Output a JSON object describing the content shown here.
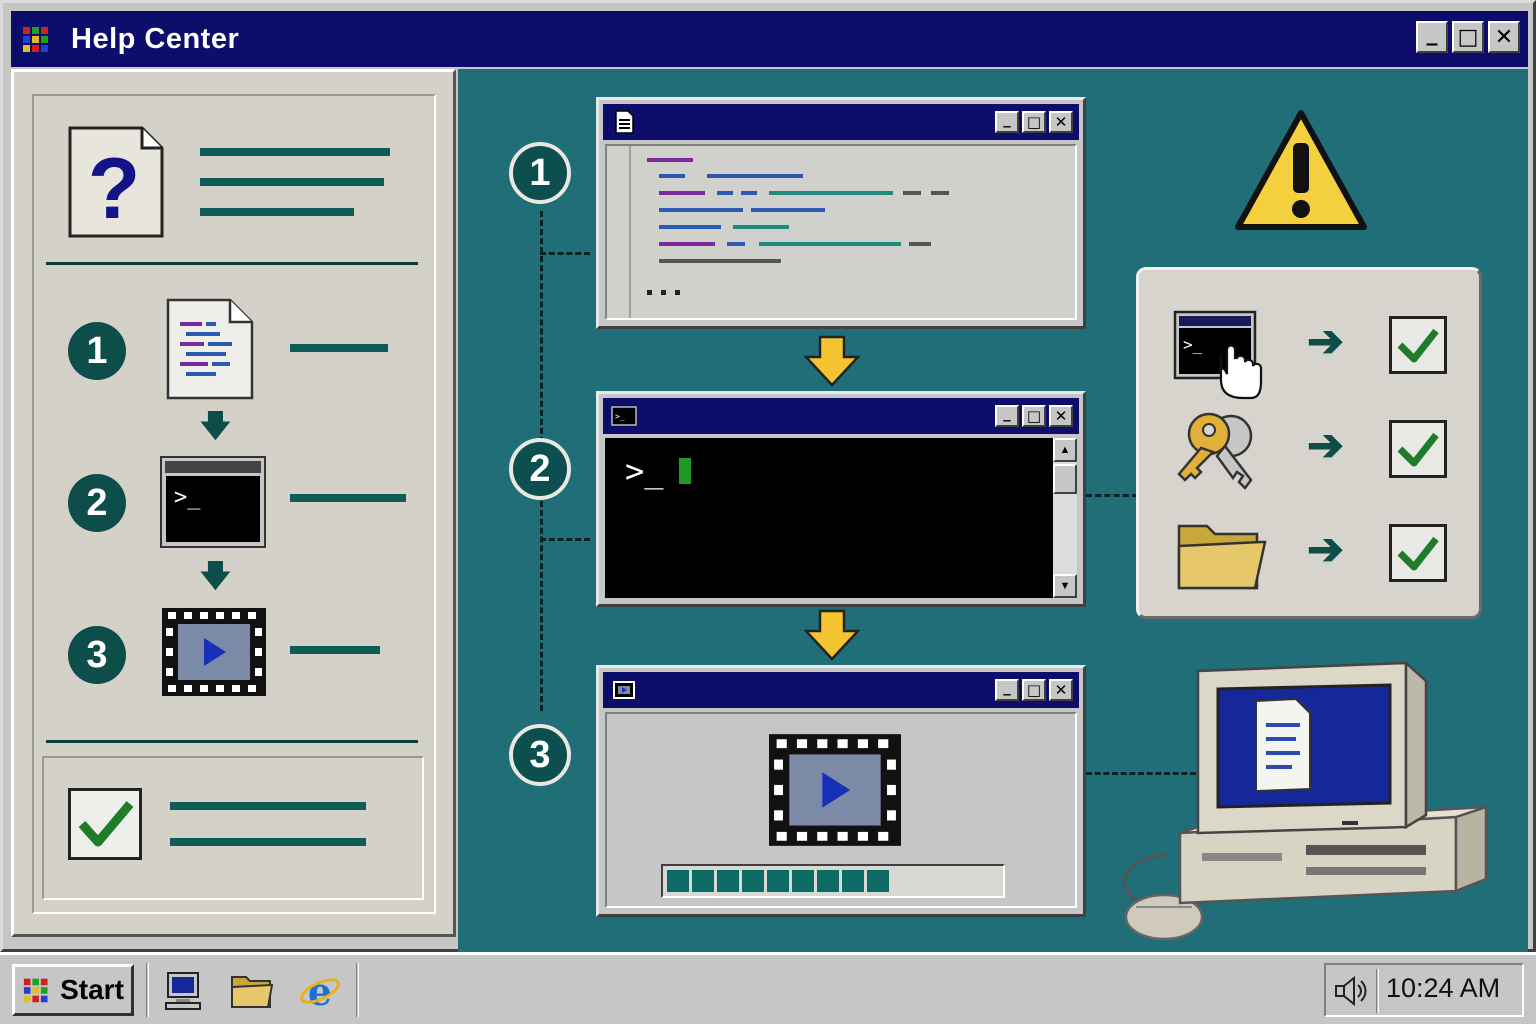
{
  "window": {
    "title": "Help Center",
    "minimize_glyph": "_",
    "maximize_glyph": "□",
    "close_glyph": "✕"
  },
  "sidebar": {
    "help_icon": "help-document-icon",
    "steps": [
      {
        "number": "1",
        "icon": "code-document-icon"
      },
      {
        "number": "2",
        "icon": "terminal-icon"
      },
      {
        "number": "3",
        "icon": "video-play-icon"
      }
    ],
    "footer_icon": "checkmark-icon"
  },
  "flow": {
    "steps": [
      {
        "number": "1",
        "window_icon": "document-icon",
        "kind": "code-editor"
      },
      {
        "number": "2",
        "window_icon": "terminal-icon",
        "kind": "terminal",
        "prompt": ">_"
      },
      {
        "number": "3",
        "window_icon": "film-icon",
        "kind": "video-player",
        "progress": 0.71
      }
    ],
    "warning_icon": "warning-icon"
  },
  "checklist": {
    "items": [
      {
        "icon": "terminal-click-icon",
        "status": "checked"
      },
      {
        "icon": "key-icon",
        "status": "checked"
      },
      {
        "icon": "folder-icon",
        "status": "checked"
      }
    ]
  },
  "taskbar": {
    "start_label": "Start",
    "quick_launch": [
      "computer-icon",
      "folder-icon",
      "browser-icon"
    ],
    "clock": "10:24 AM",
    "tray_icon": "speaker-icon"
  },
  "colors": {
    "titlebar": "#0d0d6b",
    "desktop_teal": "#1f6e78",
    "accent_teal": "#0d5c58",
    "check_green": "#1e7d2a",
    "warning_yellow": "#f4d03f"
  }
}
